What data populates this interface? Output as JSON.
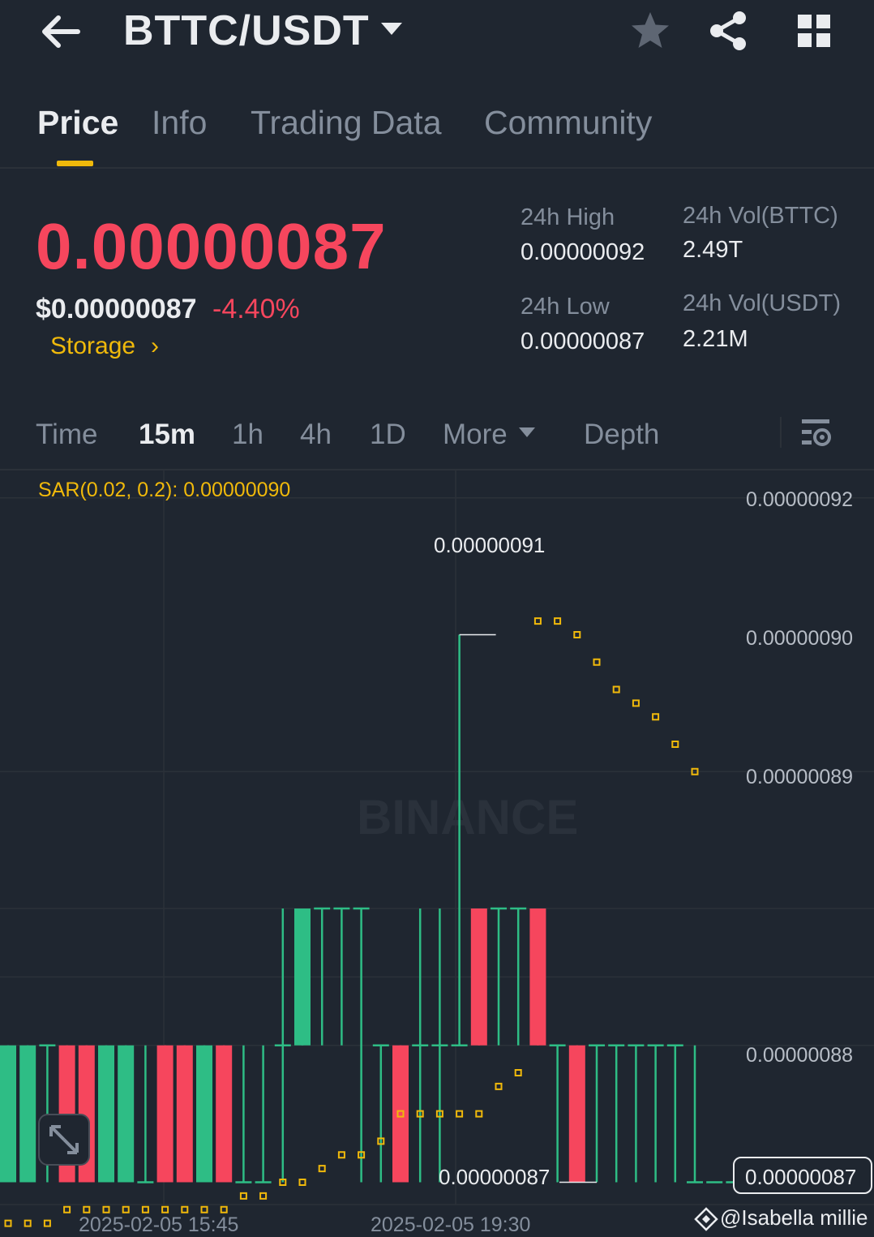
{
  "header": {
    "pair": "BTTC/USDT",
    "icons": [
      "back-arrow-icon",
      "caret-down-icon",
      "star-icon",
      "share-icon",
      "grid-icon"
    ]
  },
  "tabs": [
    {
      "label": "Price",
      "active": true
    },
    {
      "label": "Info",
      "active": false
    },
    {
      "label": "Trading Data",
      "active": false
    },
    {
      "label": "Community",
      "active": false
    }
  ],
  "ticker": {
    "last_price": "0.00000087",
    "usd_price": "$0.00000087",
    "change": "-4.40%",
    "storage_label": "Storage",
    "high_label": "24h High",
    "high_value": "0.00000092",
    "low_label": "24h Low",
    "low_value": "0.00000087",
    "vol_base_label": "24h Vol(BTTC)",
    "vol_base_value": "2.49T",
    "vol_quote_label": "24h Vol(USDT)",
    "vol_quote_value": "2.21M"
  },
  "intervals": [
    {
      "label": "Time",
      "active": false
    },
    {
      "label": "15m",
      "active": true
    },
    {
      "label": "1h",
      "active": false
    },
    {
      "label": "4h",
      "active": false
    },
    {
      "label": "1D",
      "active": false
    },
    {
      "label": "More",
      "active": false
    },
    {
      "label": "Depth",
      "active": false
    }
  ],
  "indicator": "SAR(0.02, 0.2): 0.00000090",
  "watermark": "@Isabella millie",
  "colors": {
    "up": "#2ebd85",
    "down": "#f6465d",
    "accent": "#f0b90b",
    "bg": "#1f2630"
  },
  "chart_data": {
    "type": "candlestick",
    "y_ticks": [
      "0.00000092",
      "0.00000090",
      "0.00000089",
      "0.00000088"
    ],
    "x_ticks": [
      "2025-02-05 15:45",
      "2025-02-05 19:30"
    ],
    "ylim": [
      8.66e-07,
      9.22e-07
    ],
    "max_label": "0.00000091",
    "min_label": "0.00000087",
    "current_price": "0.00000087",
    "candles": [
      {
        "o": 8.7e-07,
        "h": 8.8e-07,
        "l": 8.7e-07,
        "c": 8.8e-07
      },
      {
        "o": 8.7e-07,
        "h": 8.8e-07,
        "l": 8.7e-07,
        "c": 8.8e-07
      },
      {
        "o": 8.8e-07,
        "h": 8.8e-07,
        "l": 8.7e-07,
        "c": 8.8e-07
      },
      {
        "o": 8.8e-07,
        "h": 8.8e-07,
        "l": 8.7e-07,
        "c": 8.7e-07
      },
      {
        "o": 8.8e-07,
        "h": 8.8e-07,
        "l": 8.7e-07,
        "c": 8.7e-07
      },
      {
        "o": 8.7e-07,
        "h": 8.8e-07,
        "l": 8.7e-07,
        "c": 8.8e-07
      },
      {
        "o": 8.7e-07,
        "h": 8.8e-07,
        "l": 8.7e-07,
        "c": 8.8e-07
      },
      {
        "o": 8.7e-07,
        "h": 8.8e-07,
        "l": 8.7e-07,
        "c": 8.7e-07
      },
      {
        "o": 8.8e-07,
        "h": 8.8e-07,
        "l": 8.7e-07,
        "c": 8.7e-07
      },
      {
        "o": 8.8e-07,
        "h": 8.8e-07,
        "l": 8.7e-07,
        "c": 8.7e-07
      },
      {
        "o": 8.7e-07,
        "h": 8.8e-07,
        "l": 8.7e-07,
        "c": 8.8e-07
      },
      {
        "o": 8.8e-07,
        "h": 8.8e-07,
        "l": 8.7e-07,
        "c": 8.7e-07
      },
      {
        "o": 8.7e-07,
        "h": 8.8e-07,
        "l": 8.7e-07,
        "c": 8.7e-07
      },
      {
        "o": 8.7e-07,
        "h": 8.8e-07,
        "l": 8.7e-07,
        "c": 8.7e-07
      },
      {
        "o": 8.8e-07,
        "h": 8.9e-07,
        "l": 8.7e-07,
        "c": 8.8e-07
      },
      {
        "o": 8.8e-07,
        "h": 8.9e-07,
        "l": 8.8e-07,
        "c": 8.9e-07
      },
      {
        "o": 8.9e-07,
        "h": 8.9e-07,
        "l": 8.8e-07,
        "c": 8.9e-07
      },
      {
        "o": 8.9e-07,
        "h": 8.9e-07,
        "l": 8.8e-07,
        "c": 8.9e-07
      },
      {
        "o": 8.9e-07,
        "h": 8.9e-07,
        "l": 8.7e-07,
        "c": 8.9e-07
      },
      {
        "o": 8.8e-07,
        "h": 8.8e-07,
        "l": 8.7e-07,
        "c": 8.8e-07
      },
      {
        "o": 8.8e-07,
        "h": 8.8e-07,
        "l": 8.7e-07,
        "c": 8.7e-07
      },
      {
        "o": 8.8e-07,
        "h": 8.9e-07,
        "l": 8.7e-07,
        "c": 8.8e-07
      },
      {
        "o": 8.8e-07,
        "h": 8.9e-07,
        "l": 8.7e-07,
        "c": 8.8e-07
      },
      {
        "o": 8.8e-07,
        "h": 9.1e-07,
        "l": 8.8e-07,
        "c": 8.8e-07
      },
      {
        "o": 8.9e-07,
        "h": 8.9e-07,
        "l": 8.8e-07,
        "c": 8.8e-07
      },
      {
        "o": 8.9e-07,
        "h": 8.9e-07,
        "l": 8.8e-07,
        "c": 8.9e-07
      },
      {
        "o": 8.9e-07,
        "h": 8.9e-07,
        "l": 8.8e-07,
        "c": 8.9e-07
      },
      {
        "o": 8.9e-07,
        "h": 8.9e-07,
        "l": 8.8e-07,
        "c": 8.8e-07
      },
      {
        "o": 8.8e-07,
        "h": 8.8e-07,
        "l": 8.7e-07,
        "c": 8.8e-07
      },
      {
        "o": 8.8e-07,
        "h": 8.8e-07,
        "l": 8.7e-07,
        "c": 8.7e-07
      },
      {
        "o": 8.8e-07,
        "h": 8.8e-07,
        "l": 8.7e-07,
        "c": 8.8e-07
      },
      {
        "o": 8.8e-07,
        "h": 8.8e-07,
        "l": 8.7e-07,
        "c": 8.8e-07
      },
      {
        "o": 8.8e-07,
        "h": 8.8e-07,
        "l": 8.7e-07,
        "c": 8.8e-07
      },
      {
        "o": 8.8e-07,
        "h": 8.8e-07,
        "l": 8.7e-07,
        "c": 8.8e-07
      },
      {
        "o": 8.8e-07,
        "h": 8.8e-07,
        "l": 8.7e-07,
        "c": 8.8e-07
      },
      {
        "o": 8.7e-07,
        "h": 8.8e-07,
        "l": 8.7e-07,
        "c": 8.7e-07
      },
      {
        "o": 8.7e-07,
        "h": 8.7e-07,
        "l": 8.7e-07,
        "c": 8.7e-07
      },
      {
        "o": 8.7e-07,
        "h": 8.7e-07,
        "l": 8.7e-07,
        "c": 8.7e-07
      },
      {
        "o": 8.7e-07,
        "h": 8.7e-07,
        "l": 8.7e-07,
        "c": 8.7e-07
      },
      {
        "o": 8.7e-07,
        "h": 8.7e-07,
        "l": 8.7e-07,
        "c": 8.7e-07
      },
      {
        "o": 8.7e-07,
        "h": 8.7e-07,
        "l": 8.7e-07,
        "c": 8.7e-07
      },
      {
        "o": 8.7e-07,
        "h": 8.7e-07,
        "l": 8.7e-07,
        "c": 8.7e-07
      },
      {
        "o": 8.7e-07,
        "h": 8.7e-07,
        "l": 8.7e-07,
        "c": 8.7e-07
      }
    ],
    "sar": [
      8.67e-07,
      8.67e-07,
      8.67e-07,
      8.68e-07,
      8.68e-07,
      8.68e-07,
      8.68e-07,
      8.68e-07,
      8.68e-07,
      8.68e-07,
      8.68e-07,
      8.68e-07,
      8.69e-07,
      8.69e-07,
      8.7e-07,
      8.7e-07,
      8.71e-07,
      8.72e-07,
      8.72e-07,
      8.73e-07,
      8.75e-07,
      8.75e-07,
      8.75e-07,
      8.75e-07,
      8.75e-07,
      8.77e-07,
      8.78e-07,
      9.11e-07,
      9.11e-07,
      9.1e-07,
      9.08e-07,
      9.06e-07,
      9.05e-07,
      9.04e-07,
      9.02e-07,
      9e-07
    ]
  }
}
